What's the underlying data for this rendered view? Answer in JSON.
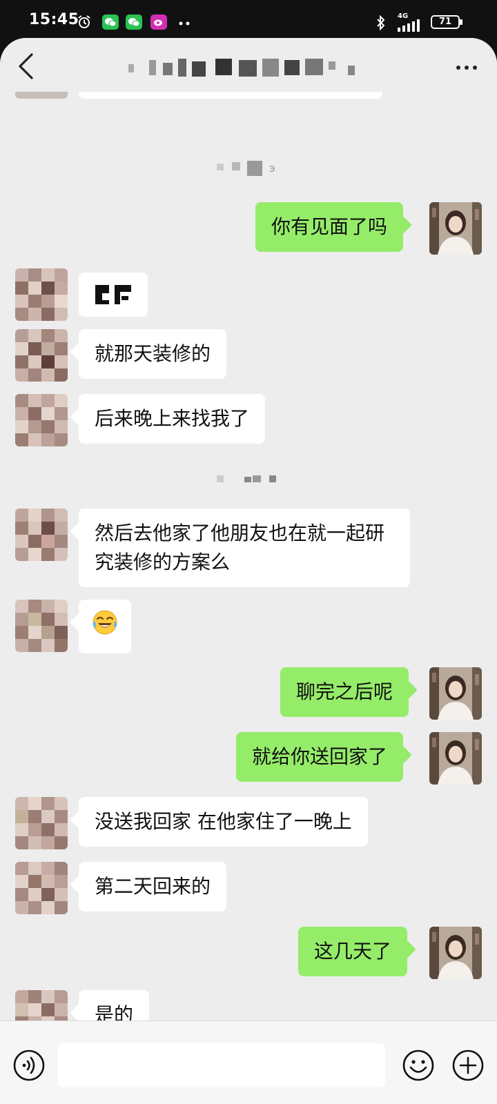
{
  "status_bar": {
    "time": "15:45",
    "network": "4G",
    "battery": "71",
    "app_icons": [
      "alarm-icon",
      "wechat-icon",
      "wechat-icon",
      "weibo-icon"
    ]
  },
  "header": {
    "back_icon": "chevron-left-icon",
    "more_icon": "more-dots-icon"
  },
  "messages": [
    {
      "side": "right",
      "text": "你有见面了吗"
    },
    {
      "side": "left",
      "kind": "image"
    },
    {
      "side": "left",
      "text": "就那天装修的"
    },
    {
      "side": "left",
      "text": "后来晚上来找我了"
    },
    {
      "side": "left",
      "text": "然后去他家了他朋友也在就一起研究装修的方案么"
    },
    {
      "side": "left",
      "kind": "emoji",
      "text": "😂"
    },
    {
      "side": "right",
      "text": "聊完之后呢"
    },
    {
      "side": "right",
      "text": "就给你送回家了"
    },
    {
      "side": "left",
      "text": "没送我回家  在他家住了一晚上"
    },
    {
      "side": "left",
      "text": "第二天回来的"
    },
    {
      "side": "right",
      "text": "这几天了"
    },
    {
      "side": "left",
      "text": "是的"
    }
  ],
  "input_bar": {
    "voice_icon": "voice-icon",
    "emoji_icon": "emoji-face-icon",
    "plus_icon": "plus-icon",
    "input_value": ""
  },
  "colors": {
    "sent_bubble": "#95ec69",
    "received_bubble": "#ffffff",
    "chat_background": "#ededed"
  }
}
